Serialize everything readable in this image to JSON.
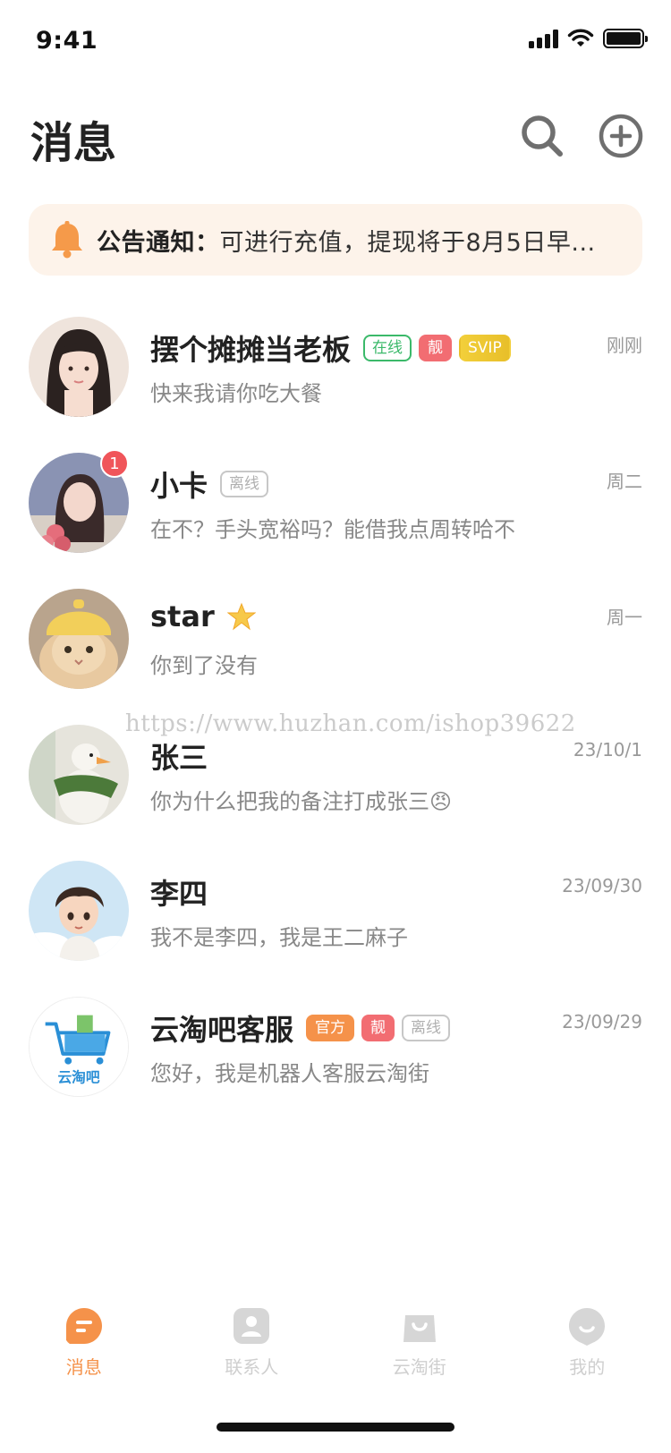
{
  "status_bar": {
    "time": "9:41"
  },
  "header": {
    "title": "消息"
  },
  "notice": {
    "label": "公告通知：",
    "text": "可进行充值，提现将于8月5日早..."
  },
  "chats": [
    {
      "name": "摆个摊摊当老板",
      "tags": [
        "在线",
        "靓",
        "SVIP"
      ],
      "message": "快来我请你吃大餐",
      "time": "刚刚"
    },
    {
      "name": "小卡",
      "tags": [
        "离线"
      ],
      "message": "在不？手头宽裕吗？能借我点周转哈不",
      "time": "周二",
      "unread": "1"
    },
    {
      "name": "star",
      "message": "你到了没有",
      "time": "周一"
    },
    {
      "name": "张三",
      "message": "你为什么把我的备注打成张三😠",
      "time": "23/10/1"
    },
    {
      "name": "李四",
      "message": "我不是李四，我是王二麻子",
      "time": "23/09/30"
    },
    {
      "name": "云淘吧客服",
      "tags": [
        "官方",
        "靓",
        "离线"
      ],
      "message": "您好，我是机器人客服云淘街",
      "time": "23/09/29",
      "avatar_text": "云淘吧"
    }
  ],
  "watermark": "https://www.huzhan.com/ishop39622",
  "tabs": [
    {
      "label": "消息",
      "active": true
    },
    {
      "label": "联系人"
    },
    {
      "label": "云淘街"
    },
    {
      "label": "我的"
    }
  ],
  "colors": {
    "accent": "#f5924a",
    "online": "#3bb96a",
    "liang": "#f26d72",
    "svip": "#e8bf2a",
    "badge": "#f0555a",
    "notice_bg": "#fdf3ea"
  }
}
